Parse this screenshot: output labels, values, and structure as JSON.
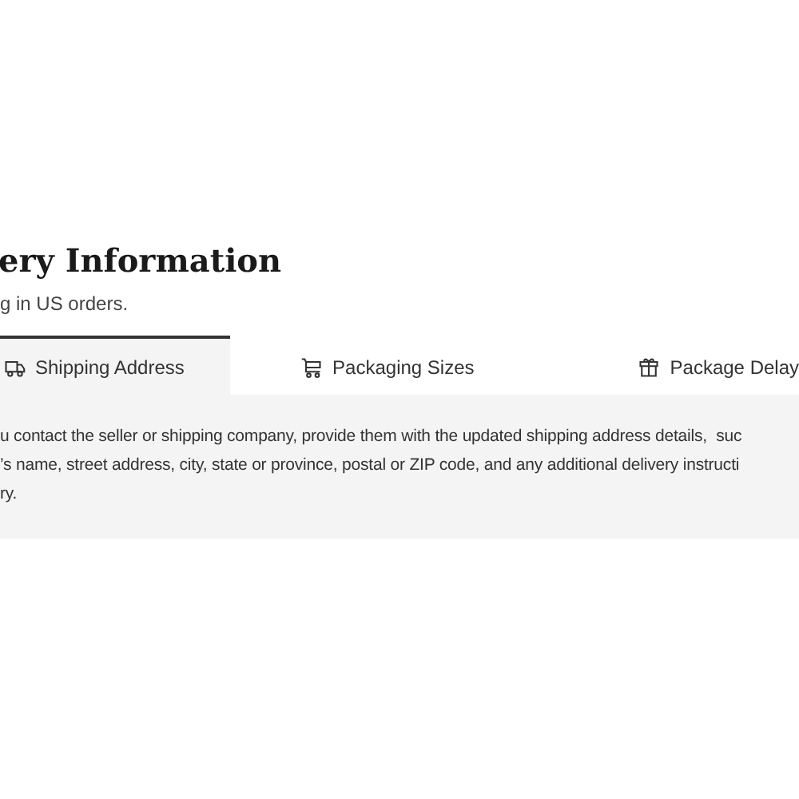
{
  "heading": {
    "title": "ery Information",
    "subtitle": "g in US orders."
  },
  "tabs": [
    {
      "label": "Shipping Address",
      "selected": true
    },
    {
      "label": "Packaging Sizes",
      "selected": false
    },
    {
      "label": "Package Delay",
      "selected": false
    }
  ],
  "panel": {
    "lines": [
      "u contact the seller or shipping company, provide them with the updated shipping address details,  suc",
      "’s name, street address, city, state or province, postal or ZIP code, and any additional delivery instructi",
      "ry."
    ]
  }
}
